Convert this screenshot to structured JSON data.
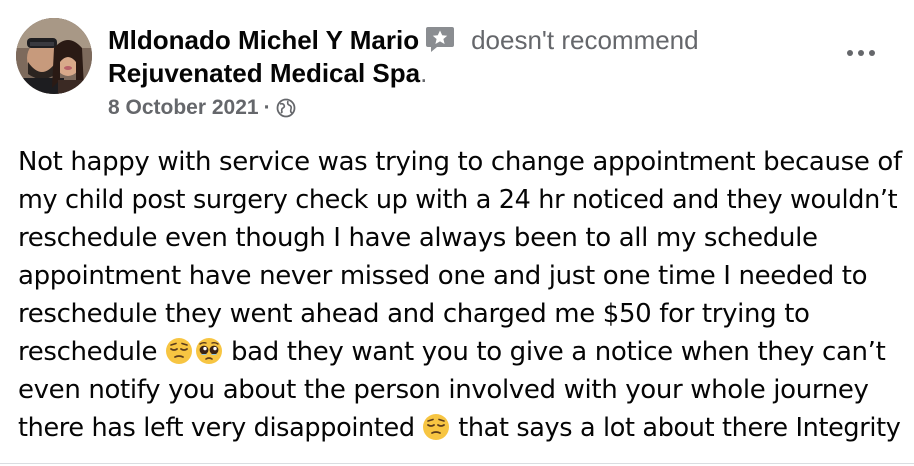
{
  "post": {
    "author_name": "Mldonado Michel Y Mario",
    "recommendation_text": "doesn't recommend",
    "page_name": "Rejuvenated Medical Spa",
    "page_suffix": ".",
    "date": "8 October 2021",
    "separator": "·",
    "audience_icon": "globe-icon",
    "more_icon": "more-options-icon",
    "review_icon": "review-star-icon",
    "body_lines": [
      "Not happy with service was trying to change appointment because of",
      "my child post surgery check up with a 24 hr noticed and they wouldn’t",
      "reschedule even though I have always been to all my schedule",
      "appointment have never missed one and just one time I needed to",
      "reschedule they went ahead and charged me $50 for trying to"
    ],
    "line6_start": "reschedule ",
    "line6_end": " bad they want you to give a notice when they can’t",
    "line7": "even notify you about the person involved with your whole journey",
    "line8_start": "there has left very disappointed ",
    "line8_end": " that says a lot about there Integrity"
  },
  "colors": {
    "text": "#050505",
    "secondary_text": "#65676b",
    "divider": "#dadde1",
    "emoji_face": "#f7c542"
  }
}
